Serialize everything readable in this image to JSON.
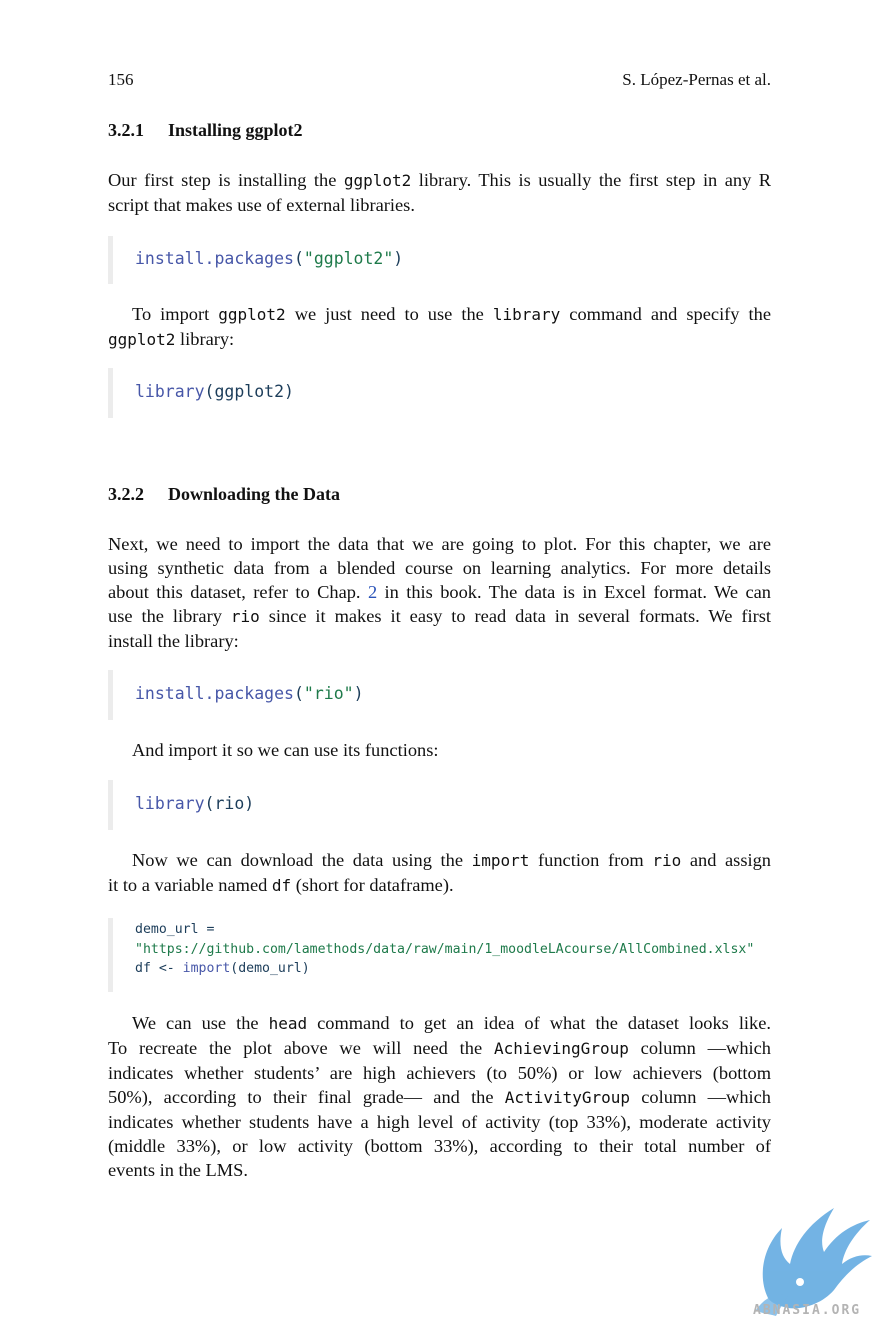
{
  "header": {
    "page_number": "156",
    "authors": "S. López-Pernas et al."
  },
  "section_1": {
    "number": "3.2.1",
    "title": "Installing ggplot2",
    "para": {
      "l1_a": "Our first step is installing the ",
      "l1_code": "ggplot2",
      "l1_b": " library. This is usually the first step in any R",
      "l2": "script that makes use of external libraries."
    },
    "code1": {
      "fn": "install.packages",
      "open": "(",
      "str": "\"ggplot2\"",
      "close": ")"
    },
    "para2": {
      "a": "To import ",
      "code_a": "ggplot2",
      "b": " we just need to use the ",
      "code_b": "library",
      "c": " command and specify the",
      "code_c": "ggplot2",
      "d": " library:"
    },
    "code2": {
      "fn": "library",
      "arg": "(ggplot2)"
    }
  },
  "section_2": {
    "number": "3.2.2",
    "title": "Downloading the Data",
    "para": {
      "l1": "Next, we need to import the data that we are going to plot. For this chapter, we are",
      "l2": "using synthetic data from a blended course on learning analytics. For more details",
      "l3_a": "about this dataset, refer to Chap. ",
      "l3_link": "2",
      "l3_b": " in this book. The data is in Excel format. We can",
      "l4_a": "use the library ",
      "l4_code": "rio",
      "l4_b": " since it makes it easy to read data in several formats. We first",
      "l5": "install the library:"
    },
    "code1": {
      "fn": "install.packages",
      "open": "(",
      "str": "\"rio\"",
      "close": ")"
    },
    "para2": "And import it so we can use its functions:",
    "code2": {
      "fn": "library",
      "arg": "(rio)"
    },
    "para3": {
      "a": "Now we can download the data using the ",
      "code_a": "import",
      "b": " function from ",
      "code_b": "rio",
      "c": " and assign",
      "d": "it to a variable named ",
      "code_d": "df",
      "e": " (short for dataframe)."
    },
    "code3": {
      "line1": "demo_url =",
      "line2": "\"https://github.com/lamethods/data/raw/main/1_moodleLAcourse/AllCombined.xlsx\"",
      "line3_a": "df <- ",
      "line3_fn": "import",
      "line3_b": "(demo_url)"
    },
    "para4": {
      "l1_a": "We can use the ",
      "l1_code": "head",
      "l1_b": " command to get an idea of what the dataset looks like.",
      "l2_a": "To recreate the plot above we will need the ",
      "l2_code": "AchievingGroup",
      "l2_b": " column —which",
      "l3": "indicates whether students’ are high achievers (to 50%) or low achievers (bottom",
      "l4_a": "50%), according to their final grade— and the ",
      "l4_code": "ActivityGroup",
      "l4_b": " column —which",
      "l5": "indicates whether students have a high level of activity (top 33%), moderate activity",
      "l6": "(middle 33%), or low activity (bottom 33%), according to their total number of",
      "l7": "events in the LMS."
    }
  },
  "watermark": {
    "text": "ABNASIA.ORG",
    "icon": "griffin-logo-icon",
    "color": "#5aa6df"
  }
}
